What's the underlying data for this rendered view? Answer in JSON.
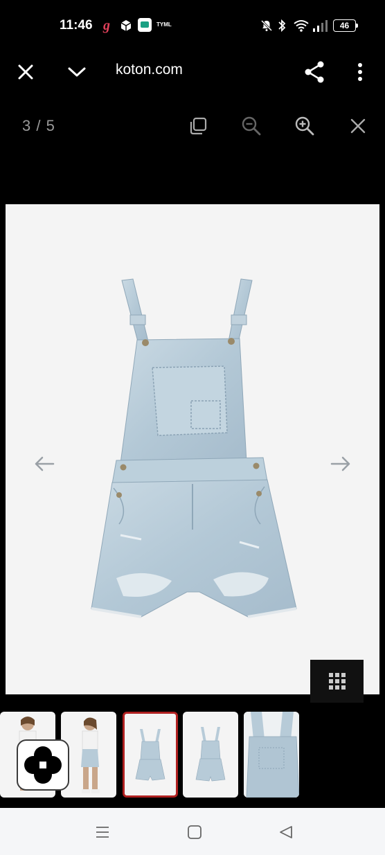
{
  "status_bar": {
    "time": "11:46",
    "battery": "46",
    "icons": [
      "g-app-icon",
      "box-app-icon",
      "chat-app-icon",
      "tyml-label",
      "mute-icon",
      "bluetooth-icon",
      "wifi-icon",
      "signal-icon",
      "battery-icon"
    ],
    "tyml": "TYML"
  },
  "toolbar": {
    "url": "koton.com",
    "close_icon": "close-icon",
    "expand_icon": "chevron-down-icon",
    "share_icon": "share-icon",
    "menu_icon": "more-vert-icon"
  },
  "viewer": {
    "counter": "3 / 5",
    "actions": [
      "copy-icon",
      "zoom-out-icon",
      "zoom-in-icon",
      "close-icon"
    ]
  },
  "image": {
    "subject": "denim-overall-shorts",
    "prev_icon": "arrow-left-icon",
    "next_icon": "arrow-right-icon",
    "grid_icon": "grid-icon"
  },
  "thumbnails": {
    "count": 5,
    "active_index": 2
  },
  "colors": {
    "background": "#000000",
    "stage": "#f4f4f4",
    "denim": "#b7cbd8",
    "active_border": "#b02020",
    "nav_bar": "#f5f6f8"
  },
  "system_nav": [
    "menu-key-icon",
    "home-key-icon",
    "back-key-icon"
  ]
}
